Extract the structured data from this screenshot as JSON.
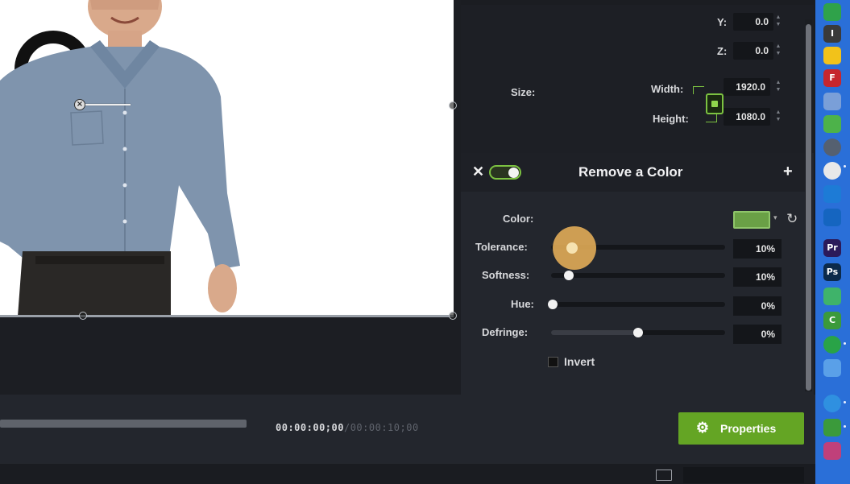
{
  "position": {
    "y_label": "Y:",
    "y_value": "0.0",
    "z_label": "Z:",
    "z_value": "0.0"
  },
  "size": {
    "label": "Size:",
    "width_label": "Width:",
    "width_value": "1920.0",
    "height_label": "Height:",
    "height_value": "1080.0"
  },
  "effect": {
    "title": "Remove a Color",
    "close": "✕",
    "add": "+",
    "enabled": true,
    "color_label": "Color:",
    "color_value": "#6aa046",
    "tolerance_label": "Tolerance:",
    "tolerance_value": "10%",
    "softness_label": "Softness:",
    "softness_value": "10%",
    "hue_label": "Hue:",
    "hue_value": "0%",
    "defringe_label": "Defringe:",
    "defringe_value": "0%",
    "invert_label": "Invert",
    "invert_checked": false
  },
  "playback": {
    "timecode_current": "00:00:00;00",
    "timecode_total": "/00:00:10;00"
  },
  "properties_button": "Properties",
  "icons": {
    "close": "close-icon",
    "add": "plus-icon",
    "reset": "reset-icon",
    "gear": "gear-icon",
    "lock": "lock-icon"
  },
  "colors": {
    "accent_green": "#64a524",
    "panel_bg": "#23262d",
    "dock_blue": "#2a6fd8"
  },
  "dock": {
    "apps": [
      "I",
      "F",
      "Pr",
      "Ps",
      "C"
    ]
  }
}
